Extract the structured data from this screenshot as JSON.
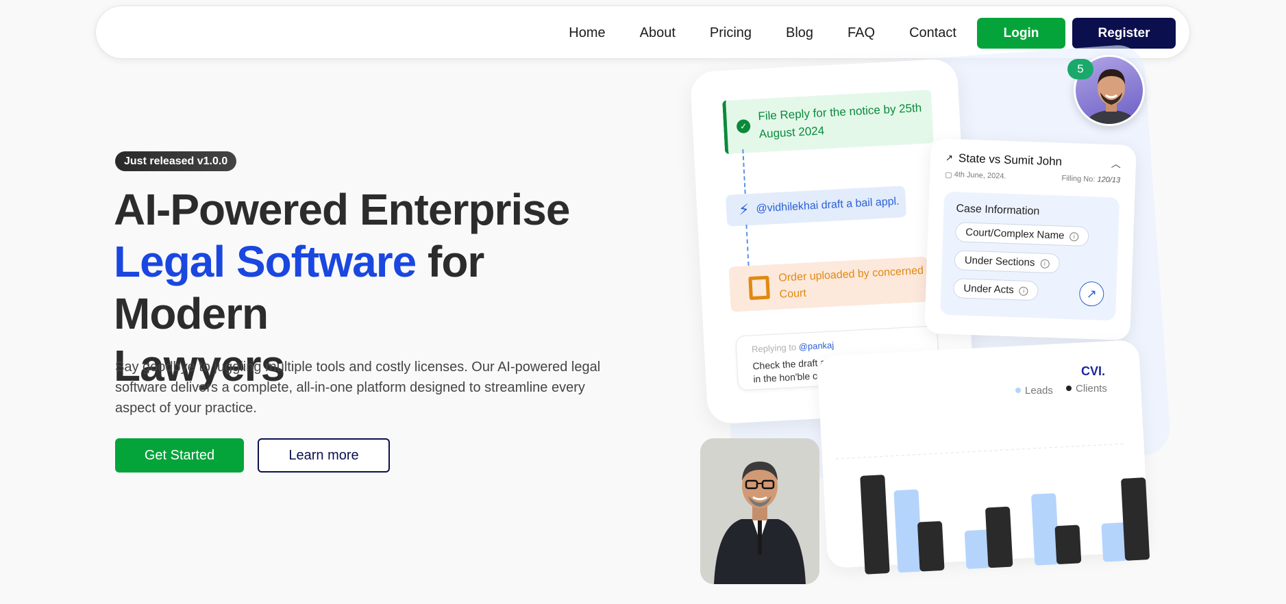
{
  "nav": {
    "links": [
      "Home",
      "About",
      "Pricing",
      "Blog",
      "FAQ",
      "Contact"
    ],
    "login": "Login",
    "register": "Register"
  },
  "hero": {
    "badge": "Just released v1.0.0",
    "title_line1": "AI-Powered Enterprise",
    "title_accent": "Legal Software",
    "title_rest": " for Modern",
    "title_line3": "Lawyers",
    "description": "Say goodbye to juggling multiple tools and costly licenses. Our AI-powered legal software delivers a complete, all-in-one platform designed to streamline every aspect of your practice.",
    "cta_primary": "Get Started",
    "cta_secondary": "Learn more"
  },
  "illustration": {
    "task1": "File Reply for the notice by 25th August 2024",
    "task2": "@vidhilekhai draft a bail appl.",
    "task3": "Order uploaded by concerned Court",
    "reply_prefix": "Replying to",
    "reply_user": "@pankaj",
    "reply_text": "Check the draft and file the petition in the hon'ble court",
    "notifications": "5",
    "case": {
      "title": "State vs Sumit John",
      "date": "4th June, 2024.",
      "filing_label": "Filling No:",
      "filing_no": "120/13",
      "info_title": "Case Information",
      "fields": [
        "Court/Complex Name",
        "Under Sections",
        "Under Acts"
      ]
    },
    "chart_legend": [
      "Leads",
      "Clients"
    ],
    "chart_logo": "CVI."
  },
  "colors": {
    "green": "#05a43b",
    "navy": "#0b0f4d",
    "accent_blue": "#1a47e0"
  },
  "chart_data": {
    "type": "bar",
    "series": [
      {
        "name": "Leads",
        "color": "#b4d4fc",
        "values": [
          0,
          7.5,
          3.5,
          6.5,
          3.5
        ]
      },
      {
        "name": "Clients",
        "color": "#2a2a2a",
        "values": [
          9,
          4.5,
          5.5,
          3.5,
          7.5
        ]
      }
    ]
  }
}
